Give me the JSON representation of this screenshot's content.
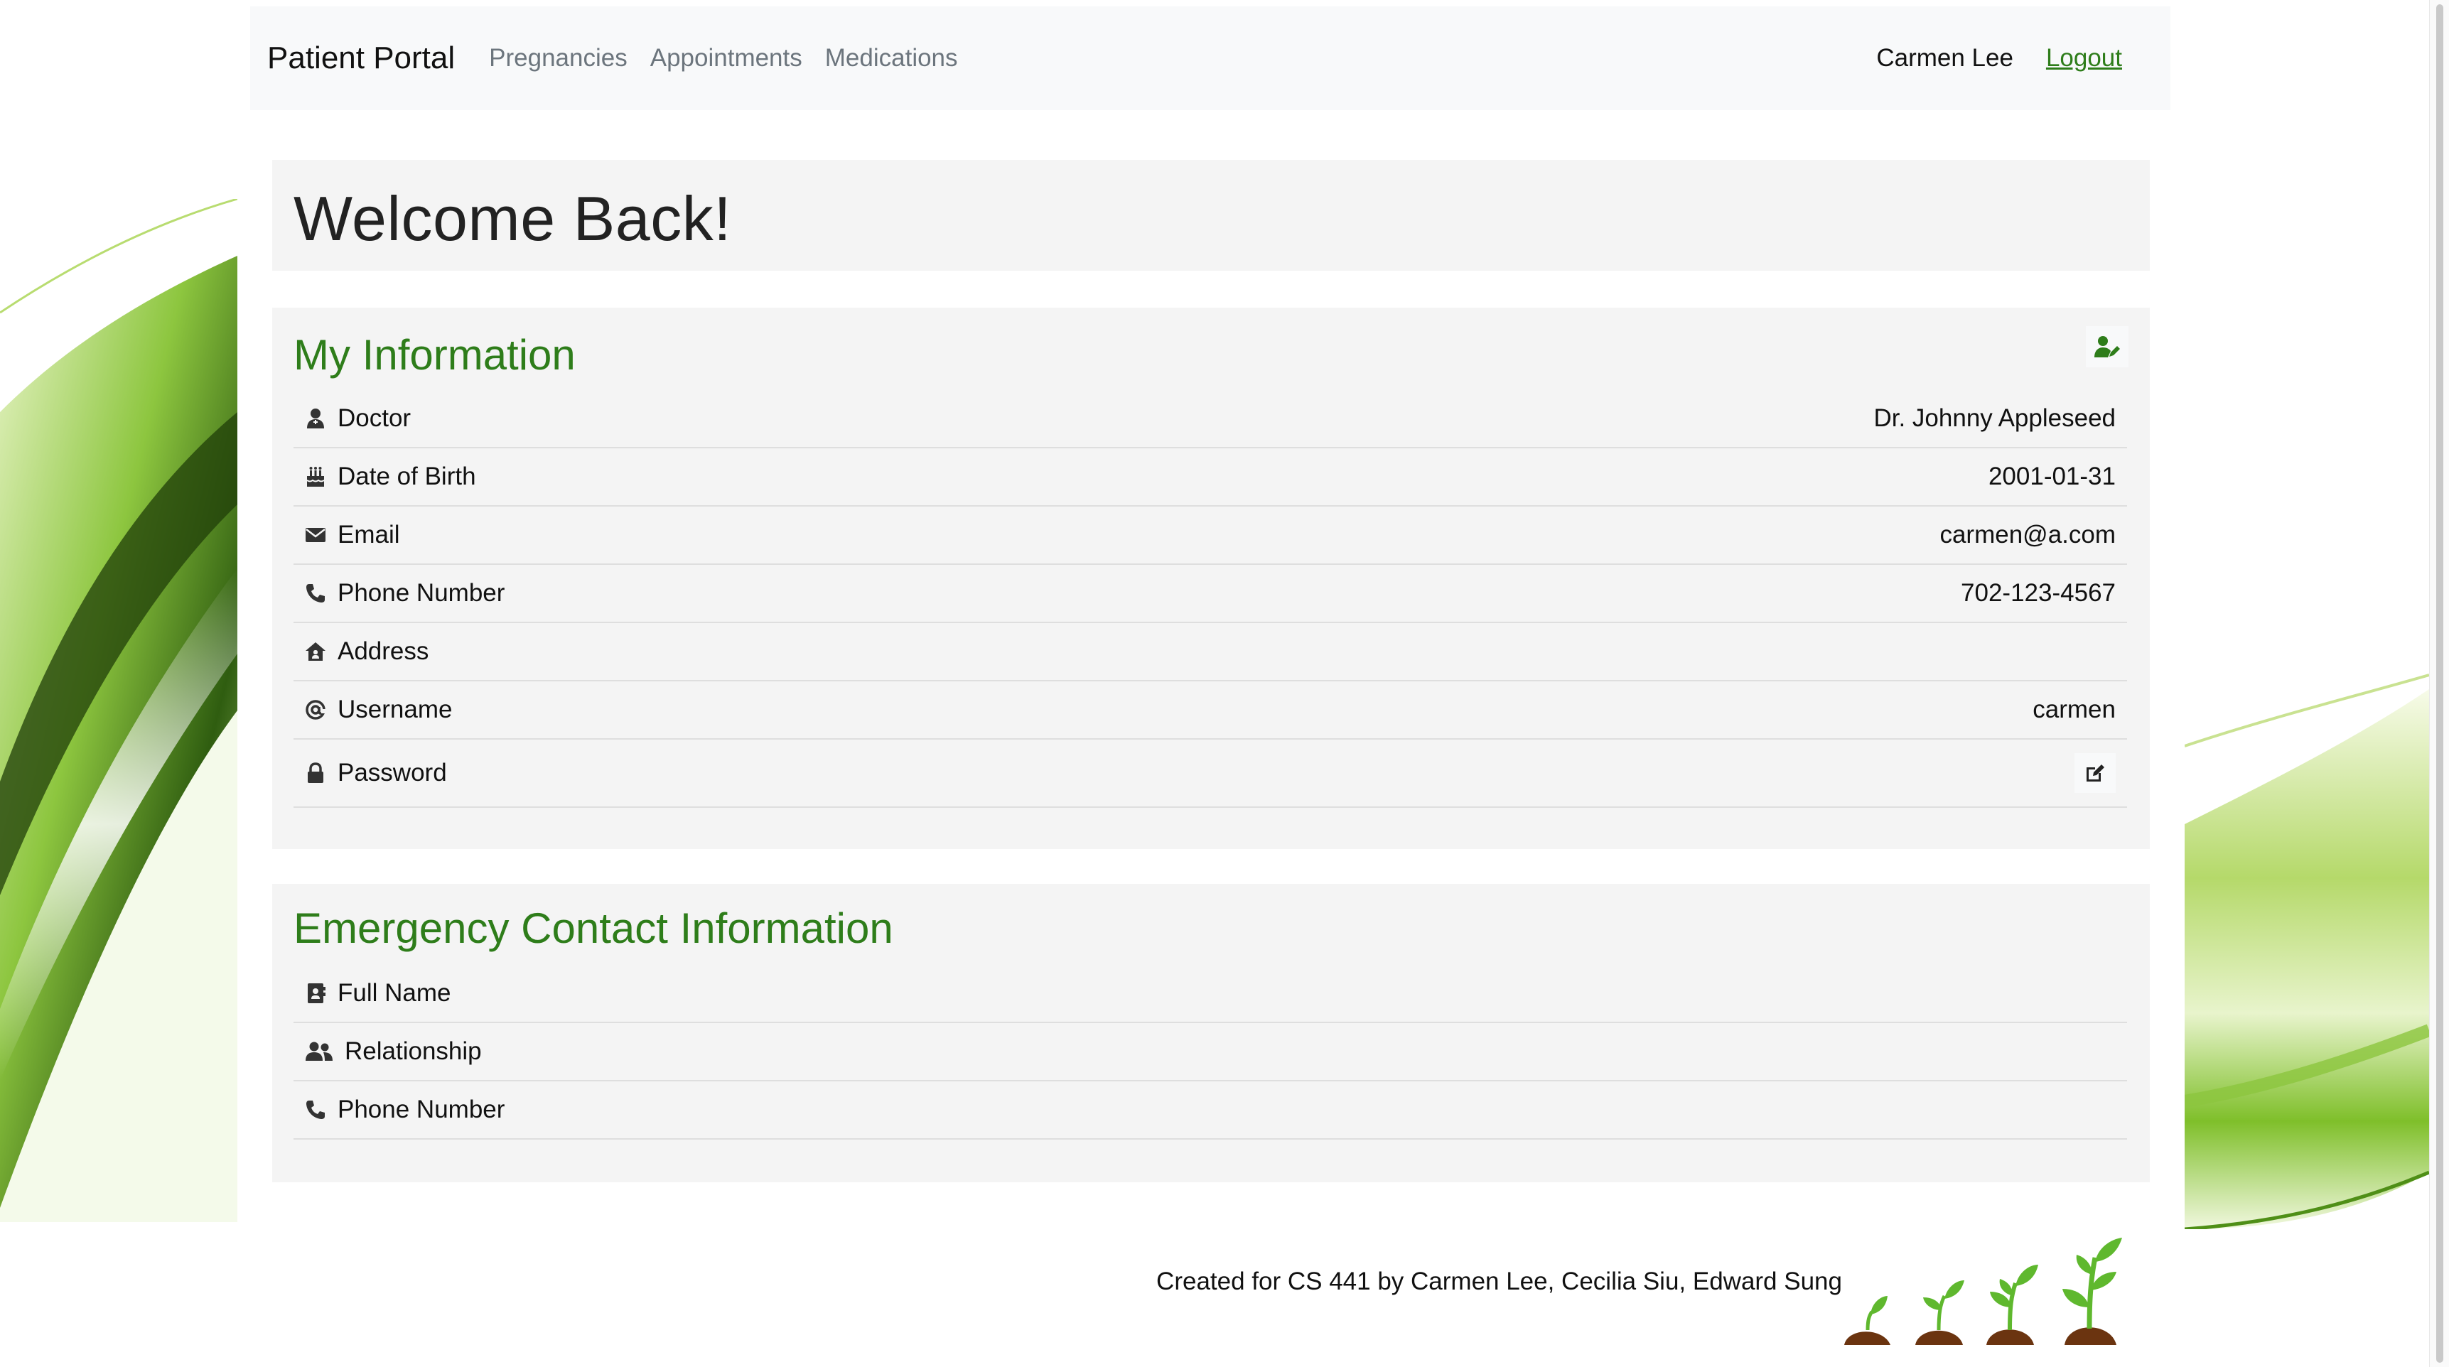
{
  "navbar": {
    "brand": "Patient Portal",
    "links": [
      "Pregnancies",
      "Appointments",
      "Medications"
    ],
    "user_name": "Carmen Lee",
    "logout_label": "Logout"
  },
  "welcome": {
    "title": "Welcome Back!"
  },
  "my_info": {
    "title": "My Information",
    "edit_icon": "user-edit-icon",
    "rows": [
      {
        "label": "Doctor",
        "value": "Dr. Johnny Appleseed",
        "icon": "user-doctor-icon"
      },
      {
        "label": "Date of Birth",
        "value": "2001-01-31",
        "icon": "birthday-cake-icon"
      },
      {
        "label": "Email",
        "value": "carmen@a.com",
        "icon": "envelope-icon"
      },
      {
        "label": "Phone Number",
        "value": "702-123-4567",
        "icon": "phone-icon"
      },
      {
        "label": "Address",
        "value": "",
        "icon": "house-icon"
      },
      {
        "label": "Username",
        "value": "carmen",
        "icon": "at-icon"
      },
      {
        "label": "Password",
        "value": "",
        "icon": "lock-icon"
      }
    ]
  },
  "emergency_contact": {
    "title": "Emergency Contact Information",
    "rows": [
      {
        "label": "Full Name",
        "value": "",
        "icon": "address-card-icon"
      },
      {
        "label": "Relationship",
        "value": "",
        "icon": "users-icon"
      },
      {
        "label": "Phone Number",
        "value": "",
        "icon": "phone-icon"
      }
    ]
  },
  "footer": {
    "credit": "Created for CS 441 by Carmen Lee, Cecilia Siu, Edward Sung"
  },
  "colors": {
    "accent_green": "#2e7d1a",
    "panel_bg": "#f4f4f4",
    "navbar_bg": "#f8f9fa",
    "soil_brown": "#6b3410",
    "leaf_green": "#5fb82e"
  }
}
